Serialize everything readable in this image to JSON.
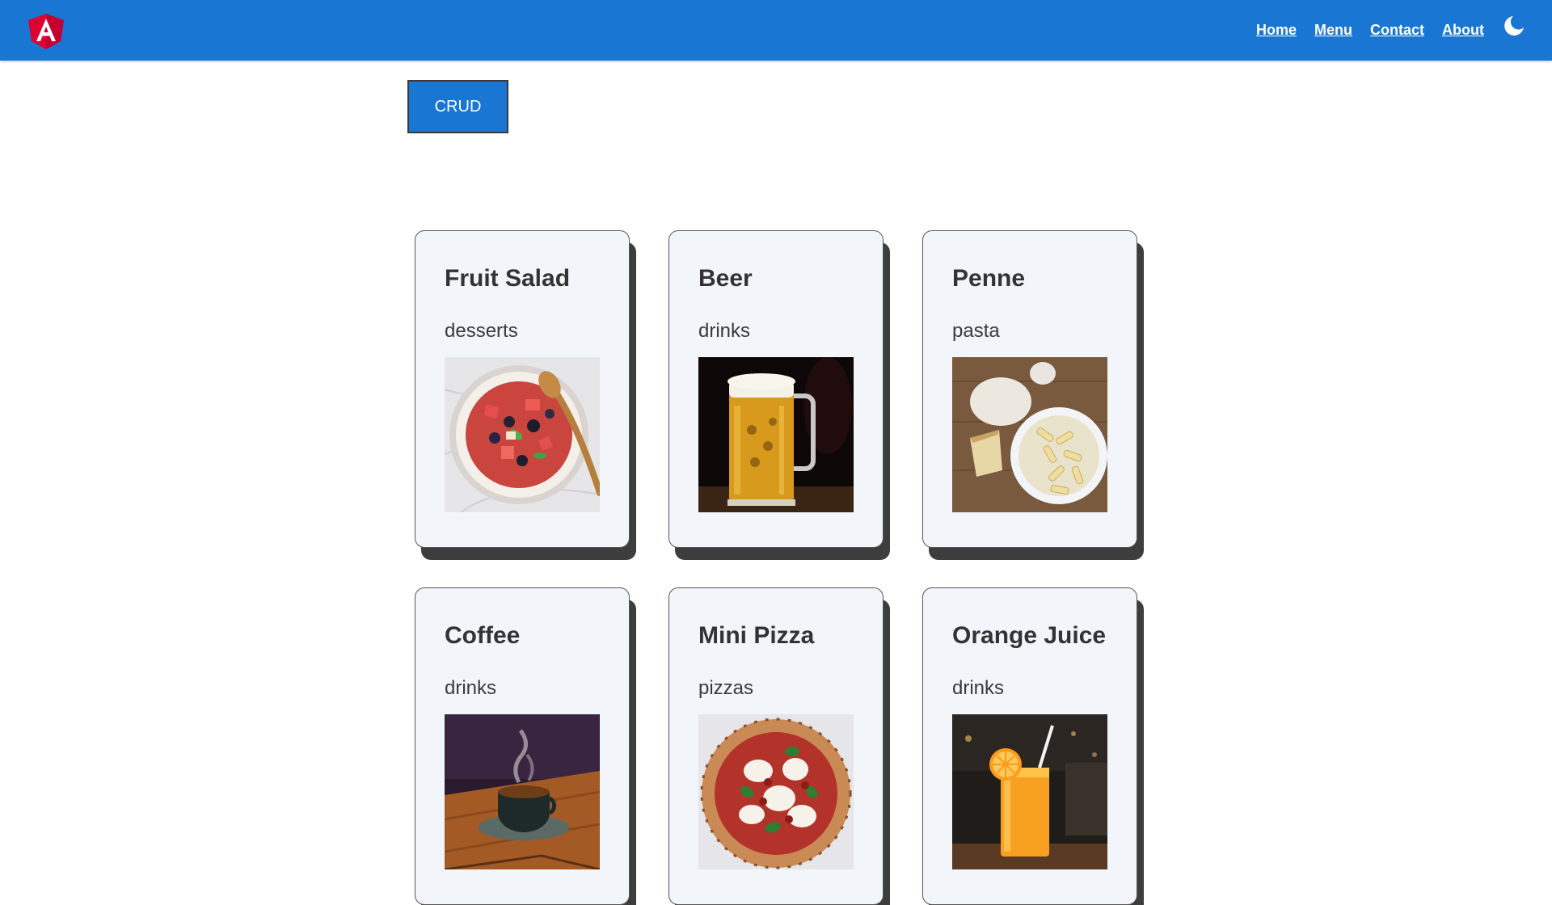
{
  "header": {
    "logo": "angular-logo",
    "nav": [
      {
        "label": "Home"
      },
      {
        "label": "Menu"
      },
      {
        "label": "Contact"
      },
      {
        "label": "About"
      }
    ],
    "theme_toggle_icon": "moon-icon"
  },
  "crud": {
    "label": "CRUD"
  },
  "items": [
    {
      "title": "Fruit Salad",
      "category": "desserts",
      "image": "fruit-salad-image"
    },
    {
      "title": "Beer",
      "category": "drinks",
      "image": "beer-image"
    },
    {
      "title": "Penne",
      "category": "pasta",
      "image": "penne-image"
    },
    {
      "title": "Coffee",
      "category": "drinks",
      "image": "coffee-image"
    },
    {
      "title": "Mini Pizza",
      "category": "pizzas",
      "image": "mini-pizza-image"
    },
    {
      "title": "Orange Juice",
      "category": "drinks",
      "image": "orange-juice-image"
    }
  ],
  "colors": {
    "navbar": "#1976d2",
    "card_background": "#f2f6fa",
    "card_shadow": "#3d3d3d"
  }
}
